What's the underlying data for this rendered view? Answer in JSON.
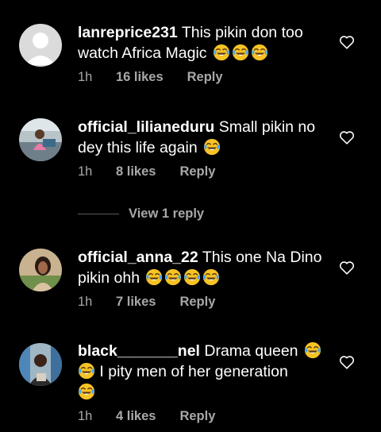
{
  "comments": [
    {
      "username": "lanreprice231",
      "text": "This pikin don too watch Africa Magic",
      "emoji_count": 3,
      "time": "1h",
      "likes": "16 likes",
      "reply_label": "Reply",
      "avatar": "default-avatar"
    },
    {
      "username": "official_lilianeduru",
      "text": "Small pikin no dey this life again",
      "emoji_count": 1,
      "time": "1h",
      "likes": "8 likes",
      "reply_label": "Reply",
      "avatar": "photo-avatar"
    },
    {
      "username": "official_anna_22",
      "text": "This one Na Dino pikin ohh",
      "emoji_count": 4,
      "time": "1h",
      "likes": "7 likes",
      "reply_label": "Reply",
      "avatar": "photo-avatar"
    },
    {
      "username": "black_______nel",
      "text_part1": "Drama queen",
      "text_part2": "I pity men of her generation",
      "emoji_count": 3,
      "time": "1h",
      "likes": "4 likes",
      "reply_label": "Reply",
      "avatar": "photo-avatar"
    }
  ],
  "view_replies": "View 1 reply",
  "icons": {
    "emoji": "face-with-tears-of-joy-icon",
    "like": "heart-outline-icon"
  },
  "colors": {
    "background": "#000000",
    "text": "#ffffff",
    "secondary": "#a8a8a8"
  }
}
